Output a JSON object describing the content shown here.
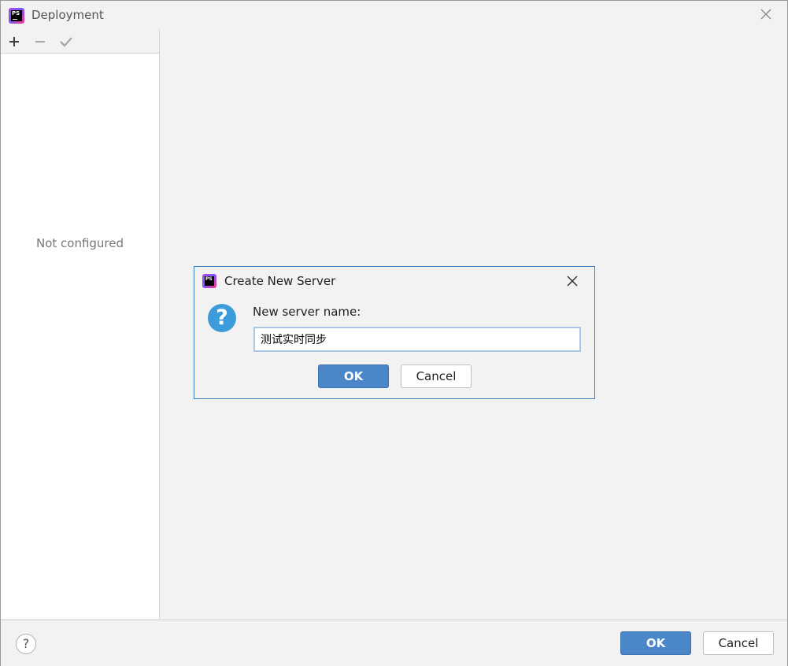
{
  "window": {
    "title": "Deployment",
    "app_icon_text": "PS"
  },
  "toolbar": {
    "add_icon": "plus-icon",
    "remove_icon": "minus-icon",
    "apply_icon": "check-icon"
  },
  "left_panel": {
    "empty_text": "Not configured"
  },
  "footer": {
    "help_label": "?",
    "ok_label": "OK",
    "cancel_label": "Cancel"
  },
  "dialog": {
    "title": "Create New Server",
    "app_icon_text": "PS",
    "prompt_label": "New server name:",
    "input_value": "测试实时同步",
    "ok_label": "OK",
    "cancel_label": "Cancel"
  },
  "colors": {
    "primary_button": "#4a86c8",
    "question_icon": "#3b9cd9",
    "dialog_border": "#3c7fc1"
  }
}
